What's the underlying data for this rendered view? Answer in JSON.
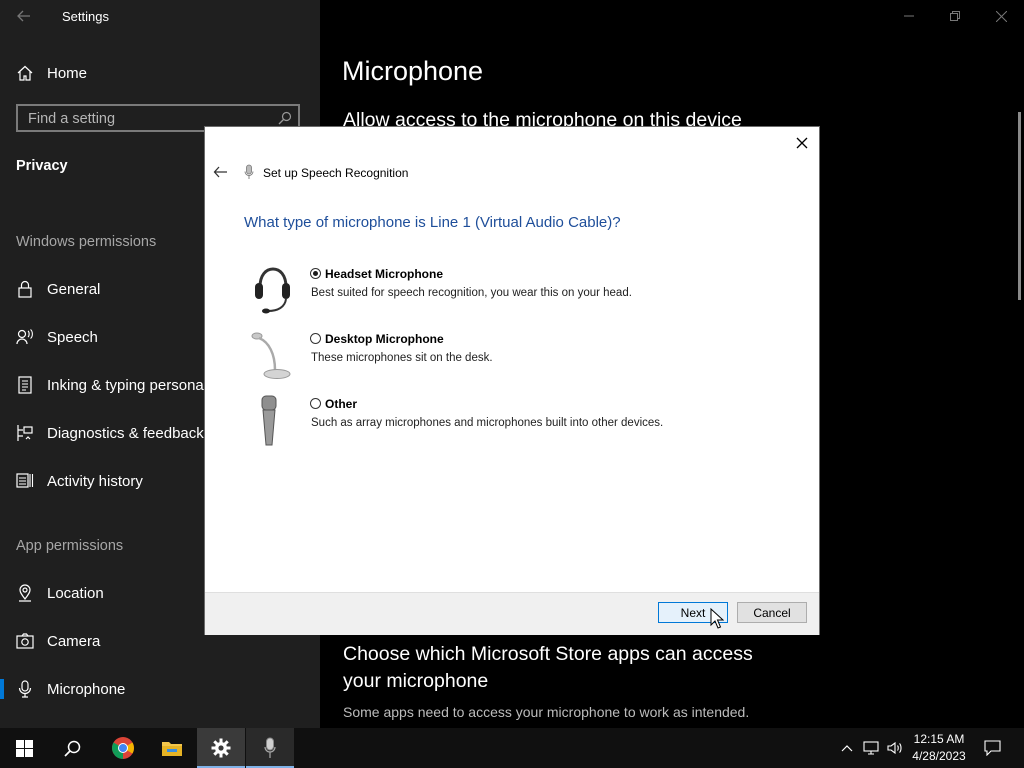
{
  "settings": {
    "window_title": "Settings",
    "home_label": "Home",
    "search_placeholder": "Find a setting",
    "privacy_heading": "Privacy",
    "windows_permissions_label": "Windows permissions",
    "windows_permissions": [
      {
        "label": "General",
        "icon": "lock-icon"
      },
      {
        "label": "Speech",
        "icon": "speech-icon"
      },
      {
        "label": "Inking & typing personalization",
        "icon": "inking-icon"
      },
      {
        "label": "Diagnostics & feedback",
        "icon": "diagnostics-icon"
      },
      {
        "label": "Activity history",
        "icon": "activity-icon"
      }
    ],
    "app_permissions_label": "App permissions",
    "app_permissions": [
      {
        "label": "Location",
        "icon": "location-icon"
      },
      {
        "label": "Camera",
        "icon": "camera-icon"
      },
      {
        "label": "Microphone",
        "icon": "microphone-icon",
        "selected": true
      }
    ]
  },
  "main": {
    "title": "Microphone",
    "subheading": "Allow access to the microphone on this device",
    "store_heading": "Choose which Microsoft Store apps can access your microphone",
    "store_desc": "Some apps need to access your microphone to work as intended."
  },
  "dialog": {
    "title": "Set up Speech Recognition",
    "question": "What type of microphone is Line 1 (Virtual Audio Cable)?",
    "options": [
      {
        "title": "Headset Microphone",
        "desc": "Best suited for speech recognition, you wear this on your head.",
        "checked": true
      },
      {
        "title": "Desktop Microphone",
        "desc": "These microphones sit on the desk.",
        "checked": false
      },
      {
        "title": "Other",
        "desc": "Such as array microphones and microphones built into other devices.",
        "checked": false
      }
    ],
    "next_label": "Next",
    "cancel_label": "Cancel"
  },
  "taskbar": {
    "time": "12:15 AM",
    "date": "4/28/2023",
    "apps": [
      "windows-start-icon",
      "search-icon",
      "chrome-icon",
      "file-explorer-icon",
      "settings-gear-icon",
      "microphone-app-icon"
    ]
  },
  "colors": {
    "accent": "#0078d7",
    "question_blue": "#1e4e9a",
    "sidebar_bg": "#1f1f1f"
  }
}
